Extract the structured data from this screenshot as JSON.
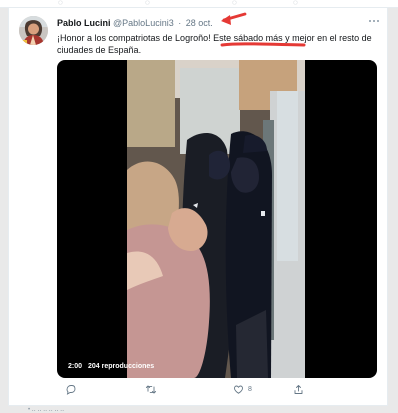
{
  "tweet": {
    "display_name": "Pablo Lucini",
    "handle": "@PabloLucini3",
    "separator": "·",
    "date": "28 oct.",
    "text": "¡Honor a los compatriotas de Logroño! Este sábado más y mejor en el resto de ciudades de España.",
    "media": {
      "duration": "2:00",
      "views": "204 reproducciones"
    },
    "actions": {
      "reply_icon": "reply-icon",
      "retweet_icon": "retweet-icon",
      "like_icon": "heart-icon",
      "like_count": "8",
      "share_icon": "share-icon"
    }
  },
  "annotation": {
    "color": "#e53935"
  },
  "colors": {
    "text_primary": "#14171a",
    "text_secondary": "#657786",
    "icon_gray": "#8899a6"
  }
}
